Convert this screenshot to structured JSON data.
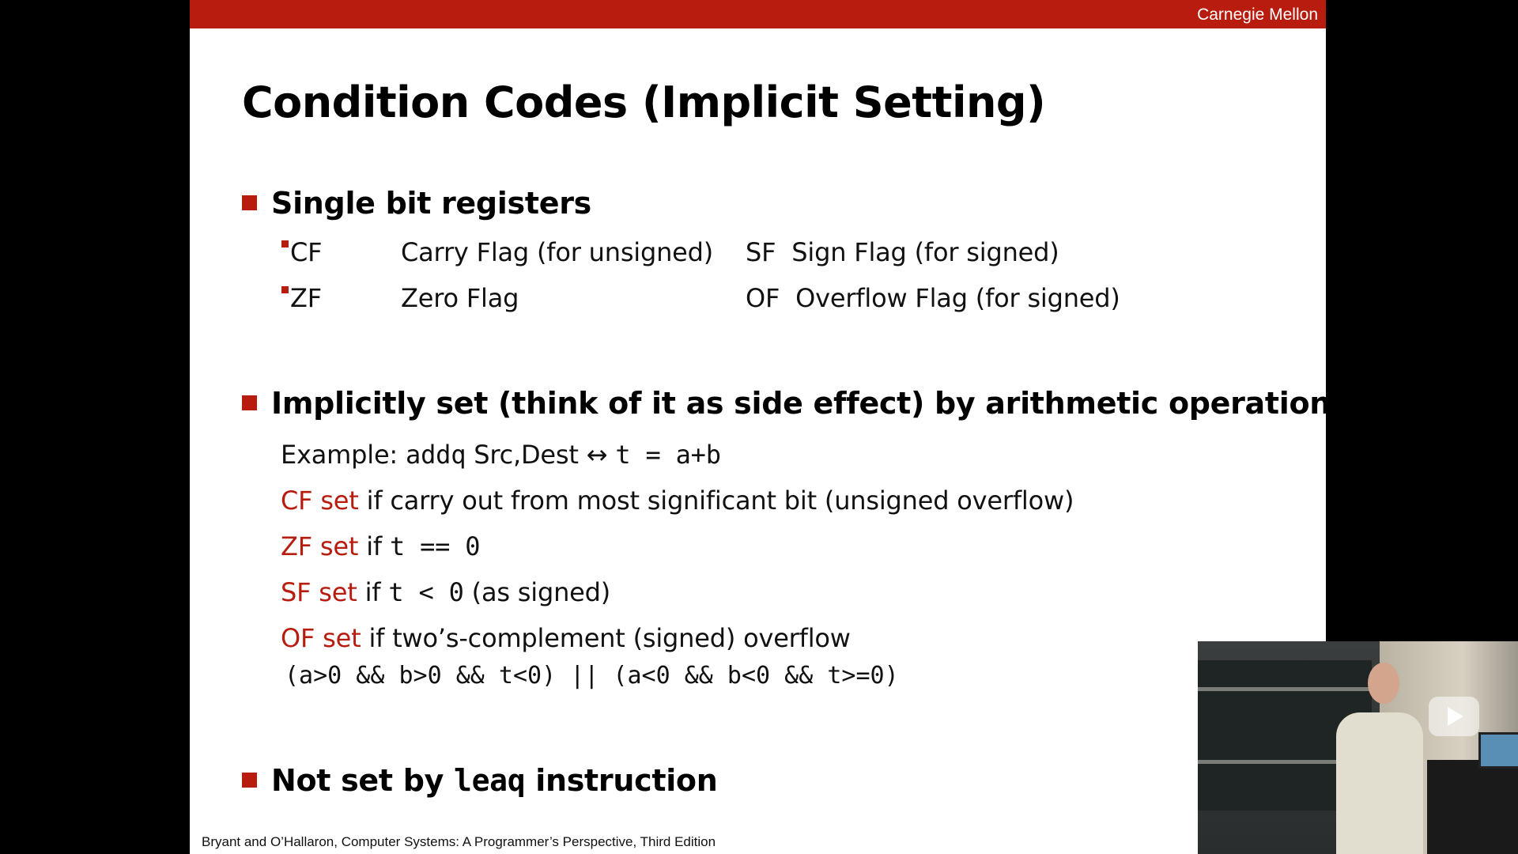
{
  "header": {
    "brand": "Carnegie Mellon",
    "accent_color": "#b71c0f"
  },
  "slide": {
    "title": "Condition Codes (Implicit Setting)",
    "section1": {
      "heading": "Single bit registers",
      "rows": [
        {
          "flag": "CF",
          "desc": "Carry Flag (for unsigned)",
          "flag2": "SF",
          "desc2": "Sign Flag (for signed)"
        },
        {
          "flag": "ZF",
          "desc": "Zero Flag",
          "flag2": "OF",
          "desc2": "Overflow Flag (for signed)"
        }
      ]
    },
    "section2": {
      "heading": "Implicitly set (think of it as side effect) by arithmetic operations",
      "example_label": "Example:",
      "example_instr": "addq",
      "example_operands": "Src,Dest",
      "example_arrow": "↔",
      "example_expr": "t = a+b",
      "cf_label": "CF set",
      "cf_text": "if carry out from most significant bit (unsigned overflow)",
      "zf_label": "ZF set",
      "zf_if": "if",
      "zf_expr": "t == 0",
      "sf_label": "SF set",
      "sf_if": "if",
      "sf_expr": "t < 0",
      "sf_suffix": "(as signed)",
      "of_label": "OF set",
      "of_text": "if two’s-complement (signed) overflow",
      "of_expr": "(a>0 && b>0 && t<0) || (a<0 && b<0 && t>=0)"
    },
    "section3": {
      "prefix": "Not set by",
      "instr": "leaq",
      "suffix": "instruction"
    },
    "footer": "Bryant and O’Hallaron, Computer Systems: A Programmer’s Perspective, Third Edition"
  },
  "video": {
    "play_icon": "play-icon"
  }
}
